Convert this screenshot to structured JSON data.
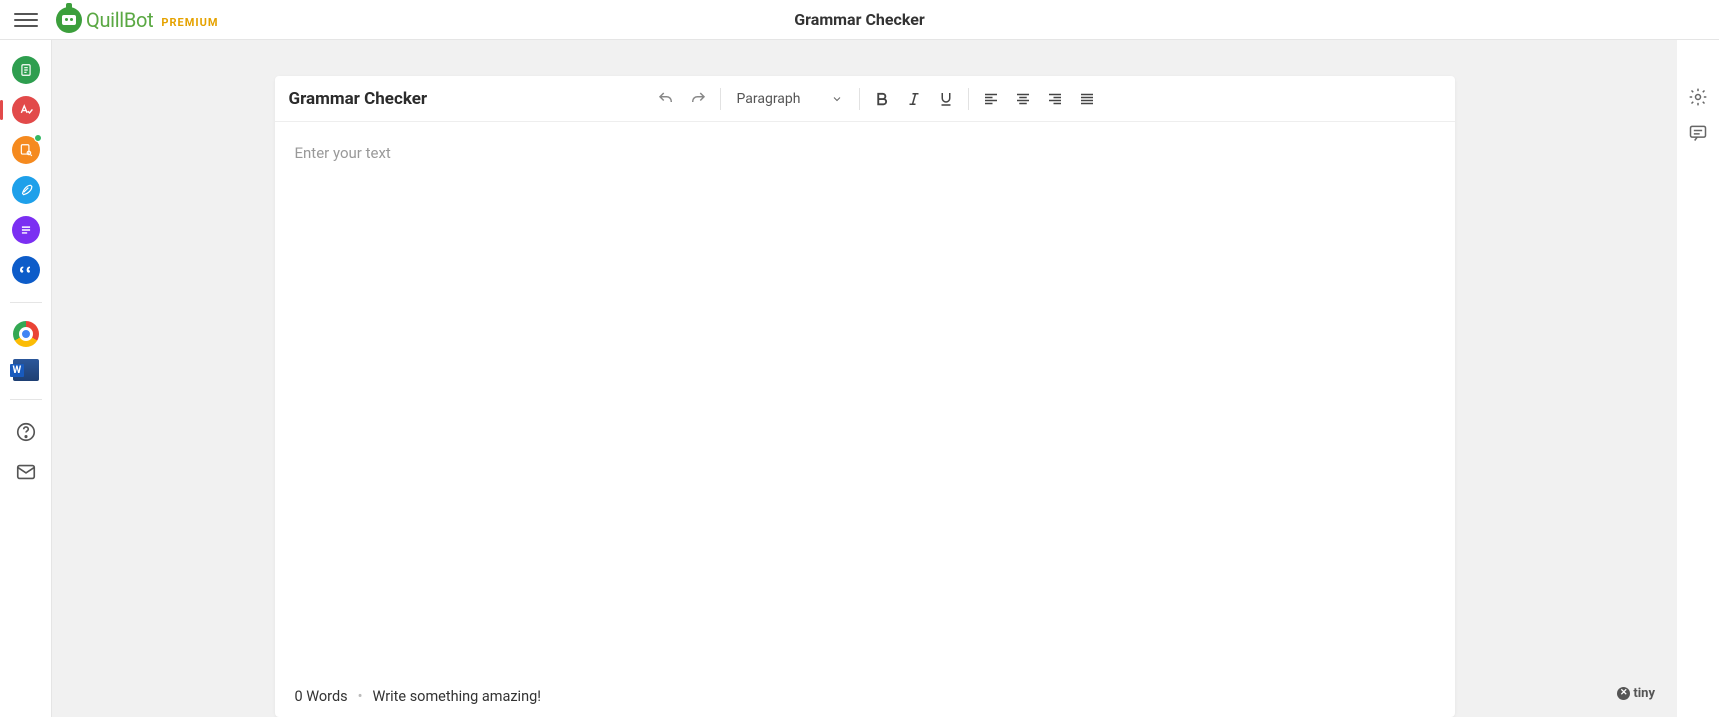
{
  "header": {
    "brand_name": "QuillBot",
    "premium_label": "PREMIUM",
    "page_title": "Grammar Checker"
  },
  "sidebar": {
    "items": [
      {
        "name": "paraphraser",
        "color": "#2e9e4f"
      },
      {
        "name": "grammar-checker",
        "color": "#e24a4a",
        "active": true
      },
      {
        "name": "plagiarism-checker",
        "color": "#f58a1f",
        "badge": true
      },
      {
        "name": "co-writer",
        "color": "#1ea0ea"
      },
      {
        "name": "summarizer",
        "color": "#7b2ff2"
      },
      {
        "name": "citation-generator",
        "color": "#0d5cc9"
      }
    ],
    "ext": {
      "chrome": "chrome-extension",
      "word": "word-extension"
    },
    "help": "help",
    "feedback": "feedback"
  },
  "editor": {
    "title": "Grammar Checker",
    "format_label": "Paragraph",
    "placeholder": "Enter your text",
    "footer_words": "0 Words",
    "footer_cta": "Write something amazing!"
  },
  "rightrail": {
    "settings": "settings",
    "comments": "comments"
  },
  "powered_by": "tiny"
}
